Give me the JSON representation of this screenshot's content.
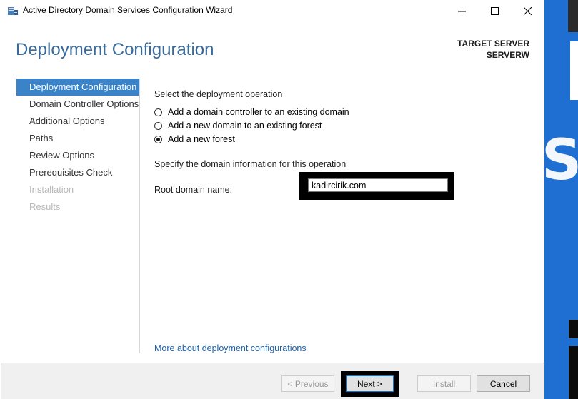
{
  "window": {
    "title": "Active Directory Domain Services Configuration Wizard",
    "minimize_glyph": "—",
    "maximize_glyph": "☐",
    "close_glyph": "✕"
  },
  "header": {
    "page_title": "Deployment Configuration",
    "target_server_label": "TARGET SERVER",
    "target_server_name": "SERVERW"
  },
  "nav": {
    "items": [
      {
        "label": "Deployment Configuration",
        "state": "active"
      },
      {
        "label": "Domain Controller Options",
        "state": "normal"
      },
      {
        "label": "Additional Options",
        "state": "normal"
      },
      {
        "label": "Paths",
        "state": "normal"
      },
      {
        "label": "Review Options",
        "state": "normal"
      },
      {
        "label": "Prerequisites Check",
        "state": "normal"
      },
      {
        "label": "Installation",
        "state": "disabled"
      },
      {
        "label": "Results",
        "state": "disabled"
      }
    ]
  },
  "main": {
    "operation_heading": "Select the deployment operation",
    "options": [
      {
        "label": "Add a domain controller to an existing domain",
        "checked": false
      },
      {
        "label": "Add a new domain to an existing forest",
        "checked": false
      },
      {
        "label": "Add a new forest",
        "checked": true
      }
    ],
    "domain_info_heading": "Specify the domain information for this operation",
    "root_domain_label": "Root domain name:",
    "root_domain_value": "kadircirik.com",
    "more_link": "More about deployment configurations"
  },
  "footer": {
    "previous_label": "< Previous",
    "next_label": "Next >",
    "install_label": "Install",
    "cancel_label": "Cancel"
  },
  "colors": {
    "title_blue": "#3a6a99",
    "nav_active_bg": "#3a83c9",
    "link_blue": "#1c5fa8",
    "highlight_frame": "#000000",
    "background_desktop": "#1e6fd1"
  }
}
